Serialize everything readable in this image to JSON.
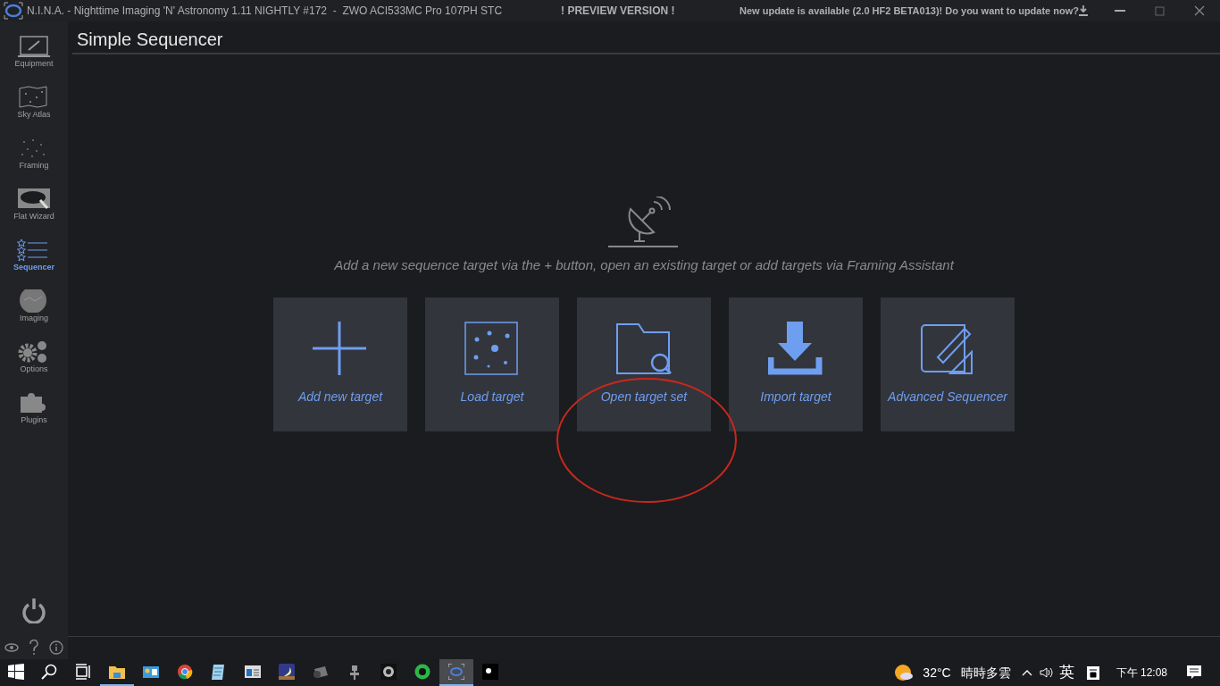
{
  "title_bar": {
    "app_title": "N.I.N.A. - Nighttime Imaging 'N' Astronomy 1.11 NIGHTLY #172  -  ZWO ACI533MC Pro 107PH STC",
    "preview_label": "! PREVIEW VERSION !",
    "update_notice": "New update is available (2.0 HF2 BETA013)! Do you want to update now?"
  },
  "sidebar": {
    "items": [
      {
        "label": "Equipment",
        "kind": "equipment",
        "selected": false
      },
      {
        "label": "Sky Atlas",
        "kind": "atlas",
        "selected": false
      },
      {
        "label": "Framing",
        "kind": "framing",
        "selected": false
      },
      {
        "label": "Flat Wizard",
        "kind": "flat",
        "selected": false
      },
      {
        "label": "Sequencer",
        "kind": "sequencer",
        "selected": true
      },
      {
        "label": "Imaging",
        "kind": "imaging",
        "selected": false
      },
      {
        "label": "Options",
        "kind": "options",
        "selected": false
      },
      {
        "label": "Plugins",
        "kind": "plugins",
        "selected": false
      }
    ]
  },
  "page": {
    "title": "Simple Sequencer",
    "hint": "Add a new sequence target via the + button, open an existing target or add targets via Framing Assistant",
    "actions": [
      {
        "label": "Add new target",
        "kind": "add"
      },
      {
        "label": "Load target",
        "kind": "load"
      },
      {
        "label": "Open target set",
        "kind": "open"
      },
      {
        "label": "Import target",
        "kind": "import"
      },
      {
        "label": "Advanced Sequencer",
        "kind": "advanced"
      }
    ]
  },
  "taskbar": {
    "apps": [
      {
        "kind": "start",
        "open": false,
        "selected": false
      },
      {
        "kind": "search",
        "open": false,
        "selected": false
      },
      {
        "kind": "taskview",
        "open": false,
        "selected": false
      },
      {
        "kind": "folder",
        "open": true,
        "selected": false
      },
      {
        "kind": "panel",
        "open": false,
        "selected": false
      },
      {
        "kind": "browser",
        "open": false,
        "selected": false
      },
      {
        "kind": "notepad",
        "open": false,
        "selected": false
      },
      {
        "kind": "window",
        "open": false,
        "selected": false
      },
      {
        "kind": "night",
        "open": false,
        "selected": false
      },
      {
        "kind": "camera",
        "open": false,
        "selected": false
      },
      {
        "kind": "mount",
        "open": false,
        "selected": false
      },
      {
        "kind": "dark",
        "open": false,
        "selected": false
      },
      {
        "kind": "green",
        "open": false,
        "selected": false
      },
      {
        "kind": "nina",
        "open": true,
        "selected": true
      },
      {
        "kind": "black",
        "open": false,
        "selected": false
      }
    ],
    "temperature": "32°C",
    "weather": "晴時多雲",
    "input_method": "英",
    "time": "下午 12:08"
  }
}
